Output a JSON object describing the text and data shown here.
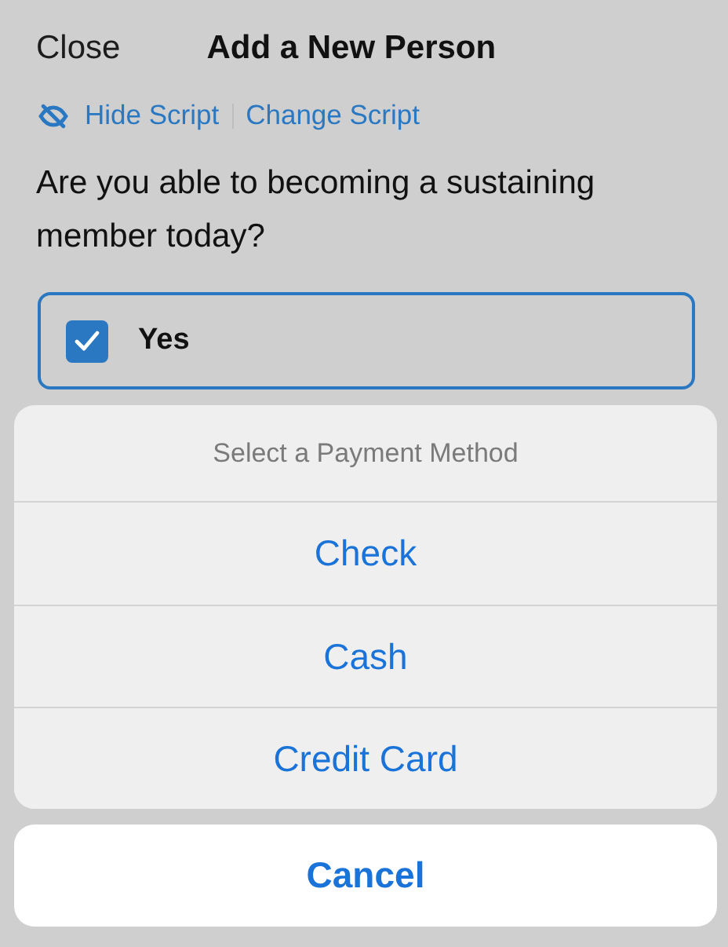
{
  "header": {
    "close": "Close",
    "title": "Add a New Person"
  },
  "script_links": [
    {
      "kind": "hide",
      "label": "Hide Script"
    },
    {
      "kind": "change",
      "label": "Change Script"
    }
  ],
  "question": "Are you able to becoming a sustaining member today?",
  "answer": {
    "label": "Yes",
    "checked": true
  },
  "action_sheet": {
    "title": "Select a Payment Method",
    "options": [
      "Check",
      "Cash",
      "Credit Card"
    ],
    "cancel": "Cancel"
  }
}
